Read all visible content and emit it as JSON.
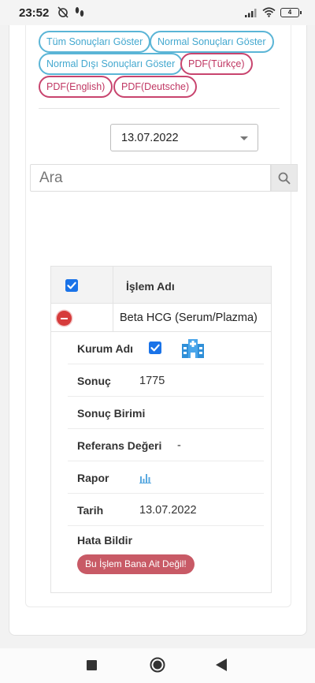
{
  "status_bar": {
    "time": "23:52",
    "battery": "4"
  },
  "filter_buttons": [
    {
      "label": "Tüm Sonuçları Göster"
    },
    {
      "label": "Normal Sonuçları Göster"
    },
    {
      "label": "Normal Dışı Sonuçları Göster"
    },
    {
      "label": "PDF(Türkçe)"
    },
    {
      "label": "PDF(English)"
    },
    {
      "label": "PDF(Deutsche)"
    }
  ],
  "date_select": {
    "value": "13.07.2022"
  },
  "search": {
    "placeholder": "Ara"
  },
  "table": {
    "header": "İşlem Adı",
    "row": {
      "name": "Beta HCG (Serum/Plazma)"
    }
  },
  "details": {
    "kurum_label": "Kurum Adı",
    "sonuc_label": "Sonuç",
    "sonuc_value": "1775",
    "birim_label": "Sonuç Birimi",
    "referans_label": "Referans Değeri",
    "referans_value": "-",
    "rapor_label": "Rapor",
    "tarih_label": "Tarih",
    "tarih_value": "13.07.2022",
    "hata_label": "Hata Bildir",
    "hata_button": "Bu İşlem Bana Ait Değil!"
  },
  "colors": {
    "accent_blue": "#43a8cf",
    "accent_red": "#c03763",
    "checkbox": "#1a73e8",
    "danger": "#d63b3b"
  }
}
